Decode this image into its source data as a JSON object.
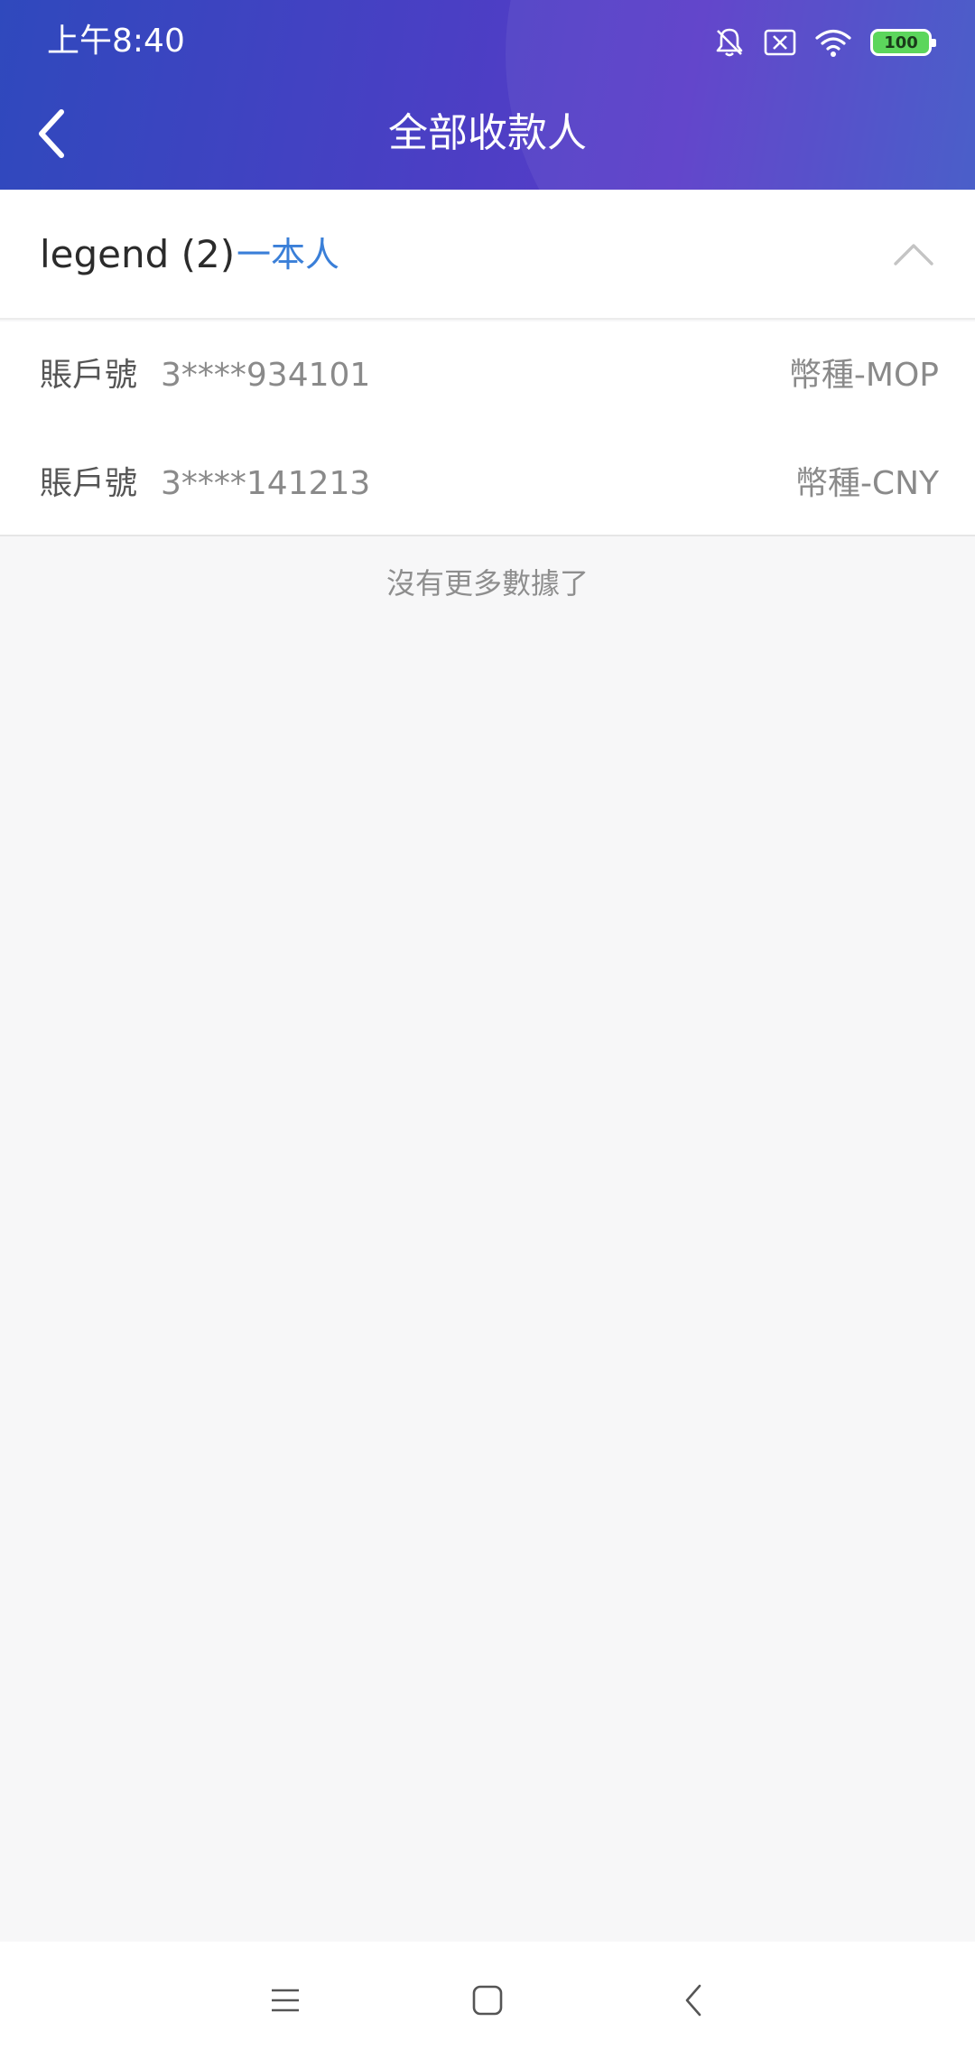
{
  "status_bar": {
    "time": "上午8:40",
    "battery_level": "100",
    "icons": [
      "notifications-off-icon",
      "sim-disabled-icon",
      "wifi-icon",
      "battery-icon"
    ]
  },
  "header": {
    "title": "全部收款人",
    "back_icon": "chevron-left-icon"
  },
  "group": {
    "name": "legend (2)",
    "tag": "一本人",
    "toggle_icon": "chevron-up-icon"
  },
  "accounts": [
    {
      "label": "賬戶號",
      "number": "3****934101",
      "currency": "幣種-MOP"
    },
    {
      "label": "賬戶號",
      "number": "3****141213",
      "currency": "幣種-CNY"
    }
  ],
  "footer_text": "沒有更多數據了",
  "colors": {
    "header_gradient_start": "#2f49bd",
    "header_gradient_mid": "#5a3bc8",
    "accent_blue": "#3a7fd8",
    "background": "#f7f7f8"
  },
  "system_nav": [
    "menu-icon",
    "home-icon",
    "back-icon"
  ]
}
